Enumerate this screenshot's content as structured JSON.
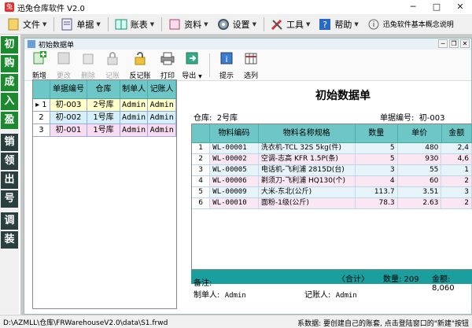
{
  "window": {
    "title": "迅兔仓库软件 V2.0",
    "minimize": "─",
    "maximize": "□",
    "close": "✕"
  },
  "menubar": [
    {
      "label": "文件",
      "icon": "file-icon"
    },
    {
      "label": "单据",
      "icon": "document-icon"
    },
    {
      "label": "账表",
      "icon": "ledger-icon"
    },
    {
      "label": "资料",
      "icon": "data-icon"
    },
    {
      "label": "设置",
      "icon": "gear-icon"
    },
    {
      "label": "工具",
      "icon": "tools-icon"
    },
    {
      "label": "帮助",
      "icon": "help-icon"
    },
    {
      "label": "迅兔软件基本概念说明",
      "icon": "info-icon"
    }
  ],
  "sidebar": {
    "group1": [
      "初",
      "购",
      "成",
      "入",
      "盈"
    ],
    "group2": [
      "销",
      "领",
      "出",
      "号"
    ],
    "group3": [
      "调",
      "装"
    ]
  },
  "child_window": {
    "title": "初始数据单"
  },
  "toolbar": [
    {
      "label": "新增",
      "enabled": true
    },
    {
      "label": "更改",
      "enabled": false
    },
    {
      "label": "删除",
      "enabled": false
    },
    {
      "label": "记账",
      "enabled": false
    },
    {
      "label": "反记账",
      "enabled": true
    },
    {
      "label": "打印",
      "enabled": true
    },
    {
      "label": "导出",
      "enabled": true
    },
    {
      "label": "提示",
      "enabled": true
    },
    {
      "label": "选列",
      "enabled": true
    }
  ],
  "left_grid": {
    "headers": [
      "单据编号",
      "仓库",
      "制单人",
      "记账人"
    ],
    "rows": [
      {
        "idx": "1",
        "marker": "▸",
        "no": "初-003",
        "wh": "2号库",
        "maker": "Admin",
        "booker": "Admin"
      },
      {
        "idx": "2",
        "marker": "",
        "no": "初-002",
        "wh": "1号库",
        "maker": "Admin",
        "booker": "Admin"
      },
      {
        "idx": "3",
        "marker": "",
        "no": "初-001",
        "wh": "1号库",
        "maker": "Admin",
        "booker": "Admin"
      }
    ]
  },
  "document": {
    "title": "初始数据单",
    "warehouse_label": "仓库:",
    "warehouse_value": "2号库",
    "number_label": "单据编号:",
    "number_value": "初-003",
    "headers": [
      "物料编码",
      "物料名称规格",
      "数量",
      "单价",
      "金额"
    ],
    "rows": [
      {
        "idx": "1",
        "code": "WL-00001",
        "name": "洗衣机-TCL 32S 5kg(件)",
        "qty": "5",
        "price": "480",
        "amount": "2,4"
      },
      {
        "idx": "2",
        "code": "WL-00002",
        "name": "空调-志高 KFR 1.5P(条)",
        "qty": "5",
        "price": "930",
        "amount": "4,6"
      },
      {
        "idx": "3",
        "code": "WL-00005",
        "name": "电话机-飞利浦 2815D(台)",
        "qty": "3",
        "price": "55",
        "amount": "1"
      },
      {
        "idx": "4",
        "code": "WL-00006",
        "name": "剃须刀-飞利浦 HQ130(个)",
        "qty": "4",
        "price": "60",
        "amount": "2"
      },
      {
        "idx": "5",
        "code": "WL-00009",
        "name": "大米-东北(公斤)",
        "qty": "113.7",
        "price": "3.51",
        "amount": "3"
      },
      {
        "idx": "6",
        "code": "WL-00010",
        "name": "面粉-1级(公斤)",
        "qty": "78.3",
        "price": "2.63",
        "amount": "2"
      }
    ],
    "total_label": "〈合计〉",
    "total_qty": "数量: 209",
    "total_amount": "金额: 8,060",
    "remark_label": "备注:",
    "maker_label": "制单人:",
    "maker_value": "Admin",
    "booker_label": "记账人:",
    "booker_value": "Admin"
  },
  "statusbar": {
    "path": "D:\\AZMLL\\仓库\\FRWarehouseV2.0\\data\\S1.frwd",
    "hint": "系数据: 要创建自己的账套, 点击登陆窗口的\"新建\"按钮"
  },
  "colors": {
    "header_teal": "#6ec6c6",
    "total_teal": "#1a9e9e",
    "sidebar_green": "#1b8a2e",
    "sidebar_dark": "#2b3f3f"
  }
}
